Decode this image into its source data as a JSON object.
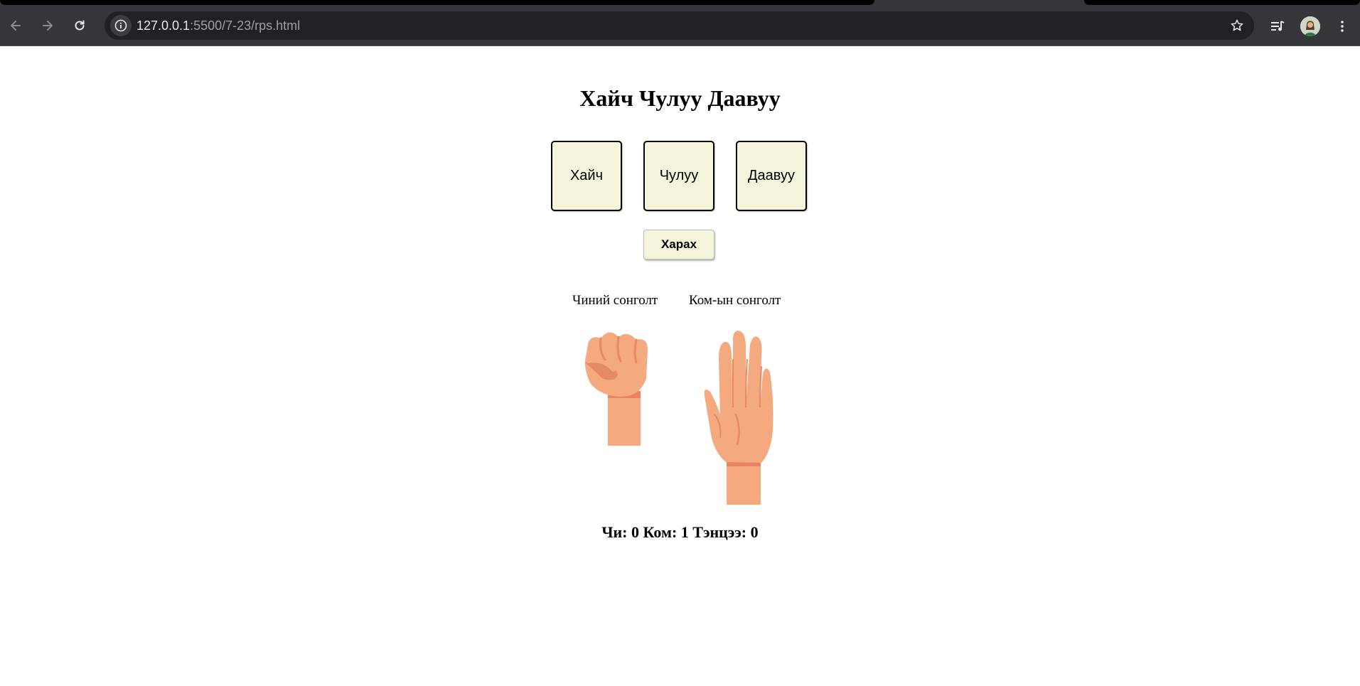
{
  "browser": {
    "url_host": "127.0.0.1",
    "url_path": ":5500/7-23/rps.html"
  },
  "game": {
    "title": "Хайч Чулуу Даавуу",
    "choices": [
      "Хайч",
      "Чулуу",
      "Даавуу"
    ],
    "show_button": "Харах",
    "player_label": "Чиний сонголт",
    "computer_label": "Ком-ын сонголт",
    "player_choice": "rock-fist",
    "computer_choice": "paper-hand",
    "score": {
      "player_label": "Чи:",
      "player": "0",
      "computer_label": "Ком:",
      "computer": "1",
      "tie_label": "Тэнцээ:",
      "tie": "0"
    }
  },
  "colors": {
    "button_bg": "#f5f5dc",
    "skin": "#f4a97f",
    "skin_shadow": "#e58a66",
    "cuff": "#ea8363",
    "chrome_bg": "#35363a",
    "omnibox_bg": "#202124"
  }
}
